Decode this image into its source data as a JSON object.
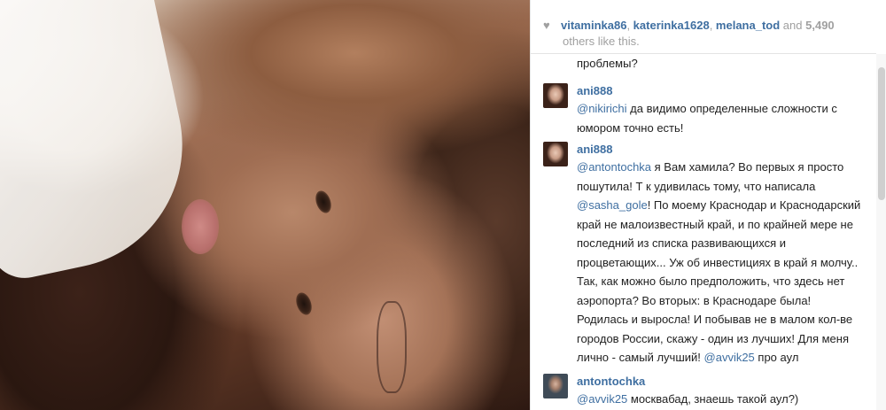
{
  "likes": {
    "users": [
      "vitaminka86",
      "katerinka1628",
      "melana_tod"
    ],
    "sep": ", ",
    "and_text": "and",
    "count": "5,490",
    "others_text": "others like this."
  },
  "comments": [
    {
      "kind": "continuation",
      "text": "проблемы?"
    },
    {
      "kind": "comment",
      "user": "ani888",
      "mention": "@nikirichi",
      "text": " да      видимо определенные сложности с юмором точно есть!"
    },
    {
      "kind": "comment",
      "user": "ani888",
      "mention": "@antontochka",
      "text_a": " я Вам хамила? Во первых я просто пошутила! Т к удивилась тому, что написала ",
      "mention2": "@sasha_gole",
      "text_b": "! По моему Краснодар и Краснодарский край не малоизвестный край, и по крайней мере не последний из списка развивающихся и процветающих... Уж об инвестициях в край я молчу.. Так, как можно было предположить, что здесь нет аэропорта? Во вторых: в Краснодаре была! Родилась и выросла! И побывав не в малом кол-ве городов России, скажу - один из лучших! Для меня лично - самый лучший! ",
      "mention3": "@avvik25",
      "text_c": " про аул"
    },
    {
      "kind": "comment",
      "user": "antontochka",
      "mention": "@avvik25",
      "text": " москвабад, знаешь такой аул?)"
    }
  ]
}
